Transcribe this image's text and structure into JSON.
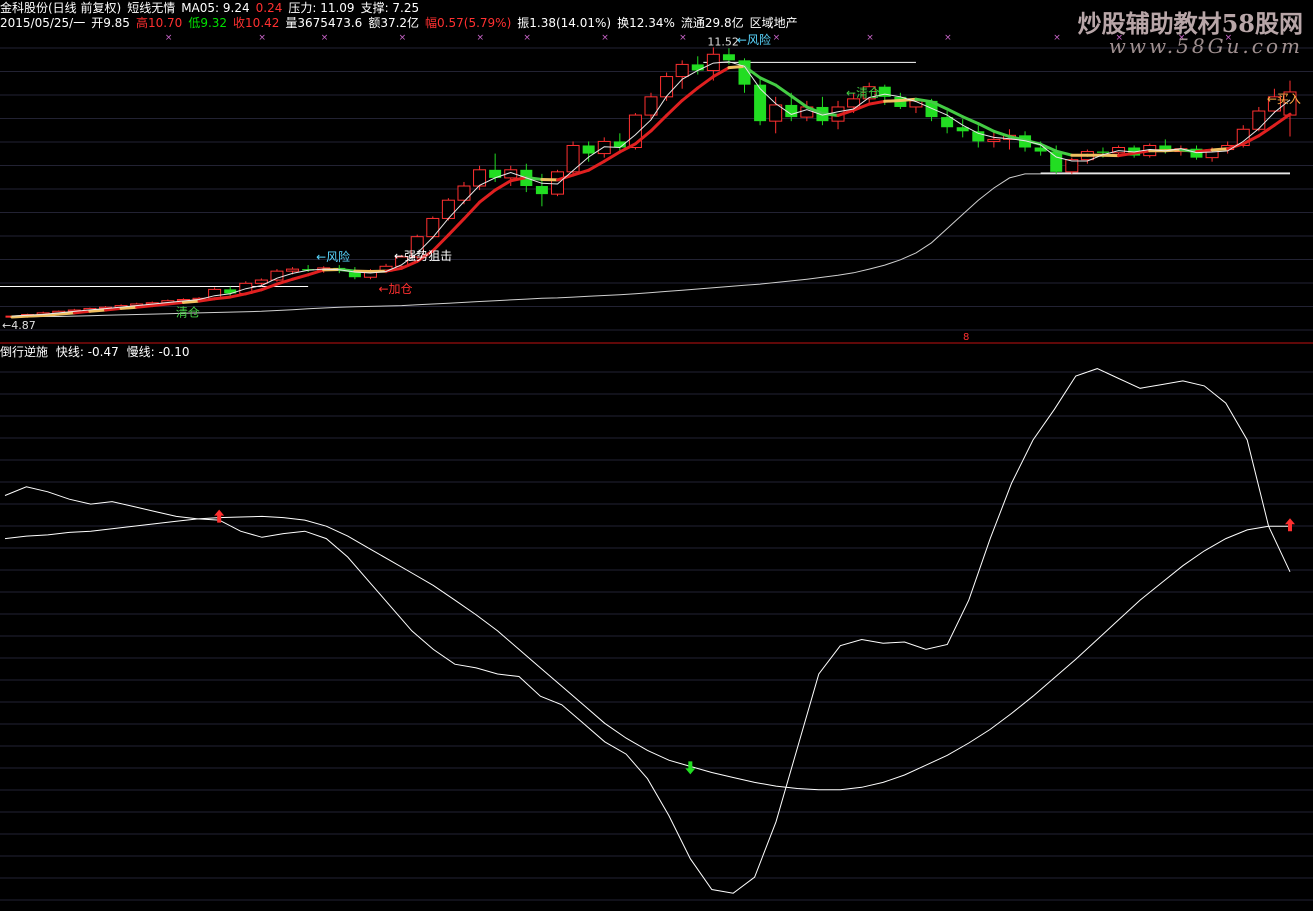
{
  "header": {
    "line1": [
      {
        "text": "金科股份(日线 前复权)",
        "color": "#ffffff"
      },
      {
        "text": "短线无情",
        "color": "#ffffff"
      },
      {
        "text": "MA05: 9.24",
        "color": "#ffffff"
      },
      {
        "text": "0.24",
        "color": "#ff3030"
      },
      {
        "text": "压力: 11.09",
        "color": "#ffffff"
      },
      {
        "text": "支撑: 7.25",
        "color": "#ffffff"
      }
    ],
    "line2": [
      {
        "text": "2015/05/25/一",
        "color": "#ffffff"
      },
      {
        "text": "开9.85",
        "color": "#ffffff"
      },
      {
        "text": "高10.70",
        "color": "#ff3030"
      },
      {
        "text": "低9.32",
        "color": "#00e000"
      },
      {
        "text": "收10.42",
        "color": "#ff3030"
      },
      {
        "text": "量3675473.6",
        "color": "#ffffff"
      },
      {
        "text": "额37.2亿",
        "color": "#ffffff"
      },
      {
        "text": "幅0.57(5.79%)",
        "color": "#ff3030"
      },
      {
        "text": "振1.38(14.01%)",
        "color": "#ffffff"
      },
      {
        "text": "换12.34%",
        "color": "#ffffff"
      },
      {
        "text": "流通29.8亿",
        "color": "#ffffff"
      },
      {
        "text": "区域地产",
        "color": "#ffffff"
      }
    ]
  },
  "watermark": {
    "line1": "炒股辅助教材58股网",
    "line2": "www.58Gu.com"
  },
  "indicator_header": {
    "name": "倒行逆施",
    "fast": "快线: -0.47",
    "slow": "慢线: -0.10"
  },
  "divider_marker": "8",
  "colors": {
    "up": "#ff3030",
    "down": "#22dd22",
    "background": "#000000",
    "line": "#ffffff",
    "grid": "#222233"
  },
  "chart_data": [
    {
      "type": "candlestick",
      "candles": [
        [
          4.87,
          4.9,
          4.84,
          4.89
        ],
        [
          4.89,
          4.95,
          4.86,
          4.93
        ],
        [
          4.93,
          5.0,
          4.9,
          4.97
        ],
        [
          4.97,
          5.03,
          4.94,
          5.01
        ],
        [
          5.01,
          5.07,
          4.98,
          5.04
        ],
        [
          5.04,
          5.1,
          5.0,
          5.08
        ],
        [
          5.08,
          5.14,
          5.04,
          5.11
        ],
        [
          5.11,
          5.18,
          5.06,
          5.15
        ],
        [
          5.15,
          5.22,
          5.1,
          5.19
        ],
        [
          5.19,
          5.25,
          5.13,
          5.22
        ],
        [
          5.22,
          5.3,
          5.18,
          5.27
        ],
        [
          5.27,
          5.33,
          5.22,
          5.3
        ],
        [
          5.3,
          5.36,
          5.25,
          5.33
        ],
        [
          5.33,
          5.6,
          5.3,
          5.55
        ],
        [
          5.55,
          5.62,
          5.4,
          5.45
        ],
        [
          5.45,
          5.75,
          5.42,
          5.7
        ],
        [
          5.7,
          5.82,
          5.62,
          5.78
        ],
        [
          5.78,
          6.05,
          5.74,
          6.0
        ],
        [
          6.0,
          6.1,
          5.92,
          6.05
        ],
        [
          6.05,
          6.15,
          5.98,
          6.02
        ],
        [
          6.02,
          6.12,
          5.96,
          6.08
        ],
        [
          6.08,
          6.15,
          5.95,
          6.01
        ],
        [
          6.01,
          6.1,
          5.8,
          5.85
        ],
        [
          5.85,
          6.05,
          5.8,
          6.0
        ],
        [
          6.0,
          6.18,
          5.95,
          6.12
        ],
        [
          6.12,
          6.4,
          6.05,
          6.35
        ],
        [
          6.35,
          6.9,
          6.3,
          6.85
        ],
        [
          6.85,
          7.35,
          6.8,
          7.3
        ],
        [
          7.3,
          7.8,
          7.25,
          7.75
        ],
        [
          7.75,
          8.2,
          7.65,
          8.1
        ],
        [
          8.1,
          8.6,
          8.0,
          8.5
        ],
        [
          8.5,
          8.9,
          8.2,
          8.3
        ],
        [
          8.3,
          8.6,
          8.1,
          8.5
        ],
        [
          8.5,
          8.65,
          7.95,
          8.1
        ],
        [
          8.1,
          8.4,
          7.6,
          7.9
        ],
        [
          7.9,
          8.5,
          7.85,
          8.45
        ],
        [
          8.45,
          9.2,
          8.4,
          9.1
        ],
        [
          9.1,
          9.2,
          8.7,
          8.9
        ],
        [
          8.9,
          9.3,
          8.8,
          9.2
        ],
        [
          9.2,
          9.4,
          8.95,
          9.05
        ],
        [
          9.05,
          9.9,
          9.0,
          9.85
        ],
        [
          9.85,
          10.4,
          9.75,
          10.3
        ],
        [
          10.3,
          10.9,
          10.2,
          10.8
        ],
        [
          10.8,
          11.2,
          10.5,
          11.1
        ],
        [
          11.1,
          11.3,
          10.85,
          10.95
        ],
        [
          10.95,
          11.52,
          10.7,
          11.35
        ],
        [
          11.35,
          11.5,
          11.1,
          11.2
        ],
        [
          11.2,
          11.25,
          10.4,
          10.6
        ],
        [
          10.6,
          10.8,
          9.6,
          9.7
        ],
        [
          9.7,
          10.3,
          9.4,
          10.1
        ],
        [
          10.1,
          10.4,
          9.7,
          9.8
        ],
        [
          9.8,
          10.2,
          9.7,
          10.05
        ],
        [
          10.05,
          10.3,
          9.6,
          9.7
        ],
        [
          9.7,
          10.2,
          9.5,
          10.05
        ],
        [
          10.05,
          10.4,
          9.9,
          10.25
        ],
        [
          10.25,
          10.65,
          10.15,
          10.55
        ],
        [
          10.55,
          10.6,
          10.1,
          10.3
        ],
        [
          10.3,
          10.4,
          10.0,
          10.05
        ],
        [
          10.05,
          10.2,
          9.9,
          10.2
        ],
        [
          10.2,
          10.25,
          9.7,
          9.8
        ],
        [
          9.8,
          9.95,
          9.4,
          9.55
        ],
        [
          9.55,
          9.75,
          9.3,
          9.45
        ],
        [
          9.45,
          9.6,
          9.05,
          9.2
        ],
        [
          9.2,
          9.45,
          9.05,
          9.25
        ],
        [
          9.25,
          9.5,
          9.0,
          9.35
        ],
        [
          9.35,
          9.45,
          8.95,
          9.05
        ],
        [
          9.05,
          9.2,
          8.85,
          8.95
        ],
        [
          8.95,
          9.1,
          8.4,
          8.45
        ],
        [
          8.45,
          8.8,
          8.4,
          8.75
        ],
        [
          8.75,
          9.0,
          8.65,
          8.95
        ],
        [
          8.95,
          9.05,
          8.8,
          8.92
        ],
        [
          8.92,
          9.1,
          8.85,
          9.05
        ],
        [
          9.05,
          9.1,
          8.8,
          8.85
        ],
        [
          8.85,
          9.15,
          8.8,
          9.1
        ],
        [
          9.1,
          9.25,
          8.9,
          8.95
        ],
        [
          8.95,
          9.1,
          8.85,
          9.02
        ],
        [
          9.02,
          9.1,
          8.75,
          8.8
        ],
        [
          8.8,
          9.05,
          8.7,
          9.0
        ],
        [
          9.0,
          9.2,
          8.9,
          9.1
        ],
        [
          9.1,
          9.6,
          9.05,
          9.5
        ],
        [
          9.5,
          10.05,
          9.45,
          9.95
        ],
        [
          9.95,
          10.5,
          9.9,
          10.3
        ],
        [
          9.85,
          10.7,
          9.32,
          10.42
        ]
      ],
      "ma5": [
        4.87,
        4.89,
        4.91,
        4.94,
        4.97,
        5.01,
        5.04,
        5.08,
        5.11,
        5.15,
        5.19,
        5.23,
        5.26,
        5.32,
        5.36,
        5.44,
        5.54,
        5.68,
        5.8,
        5.91,
        6.03,
        6.04,
        6.0,
        5.99,
        6.0,
        6.07,
        6.24,
        6.5,
        6.89,
        7.29,
        7.7,
        8.0,
        8.23,
        8.31,
        8.26,
        8.25,
        8.37,
        8.49,
        8.71,
        8.94,
        9.14,
        9.46,
        9.84,
        10.21,
        10.52,
        10.8,
        11.02,
        11.05,
        10.77,
        10.59,
        10.32,
        10.05,
        9.89,
        9.84,
        9.97,
        10.12,
        10.19,
        10.21,
        10.24,
        10.18,
        10.0,
        9.81,
        9.64,
        9.45,
        9.32,
        9.23,
        9.13,
        8.96,
        8.86,
        8.86,
        8.86,
        8.85,
        8.91,
        8.97,
        8.97,
        8.99,
        8.95,
        8.99,
        9.02,
        9.14,
        9.34,
        9.6,
        9.87
      ],
      "ma_long": [
        4.87,
        4.87,
        4.88,
        4.88,
        4.89,
        4.9,
        4.91,
        4.92,
        4.93,
        4.94,
        4.95,
        4.96,
        4.97,
        4.98,
        4.99,
        5.0,
        5.01,
        5.03,
        5.05,
        5.07,
        5.09,
        5.11,
        5.12,
        5.13,
        5.14,
        5.15,
        5.17,
        5.19,
        5.21,
        5.23,
        5.25,
        5.27,
        5.29,
        5.31,
        5.33,
        5.34,
        5.36,
        5.38,
        5.4,
        5.42,
        5.44,
        5.47,
        5.5,
        5.53,
        5.56,
        5.59,
        5.62,
        5.65,
        5.68,
        5.72,
        5.76,
        5.8,
        5.85,
        5.9,
        5.96,
        6.05,
        6.15,
        6.28,
        6.45,
        6.7,
        7.05,
        7.4,
        7.75,
        8.05,
        8.3,
        8.4,
        8.4,
        8.4,
        8.4,
        8.4,
        8.4,
        8.4,
        8.4,
        8.4,
        8.4,
        8.4,
        8.4,
        8.4,
        8.4,
        8.4,
        8.4,
        8.4,
        8.4
      ],
      "labels": {
        "low": "←4.87",
        "high": "11.52",
        "resistance": "11.09",
        "support": "7.25"
      },
      "signals": [
        {
          "i": 10,
          "text": "清仓"
        },
        {
          "i": 19,
          "text": "←风险"
        },
        {
          "i": 23,
          "text": "←加仓"
        },
        {
          "i": 24,
          "text": "←强势狙击"
        },
        {
          "i": 46,
          "text": "←风险"
        },
        {
          "i": 53,
          "text": "←清仓"
        },
        {
          "i": 80,
          "text": "←买入"
        }
      ]
    },
    {
      "type": "line",
      "title": "倒行逆施",
      "series": [
        {
          "name": "快线",
          "values": [
            0.15,
            0.22,
            0.18,
            0.12,
            0.08,
            0.1,
            0.06,
            0.02,
            -0.02,
            -0.04,
            -0.05,
            -0.14,
            -0.19,
            -0.16,
            -0.14,
            -0.2,
            -0.35,
            -0.55,
            -0.75,
            -0.95,
            -1.1,
            -1.22,
            -1.25,
            -1.3,
            -1.32,
            -1.48,
            -1.55,
            -1.7,
            -1.85,
            -1.95,
            -2.15,
            -2.45,
            -2.8,
            -3.05,
            -3.08,
            -2.95,
            -2.5,
            -1.9,
            -1.3,
            -1.07,
            -1.02,
            -1.05,
            -1.04,
            -1.1,
            -1.06,
            -0.7,
            -0.2,
            0.25,
            0.6,
            0.85,
            1.12,
            1.18,
            1.1,
            1.02,
            1.05,
            1.08,
            1.04,
            0.9,
            0.6,
            -0.1,
            -0.47
          ]
        },
        {
          "name": "慢线",
          "values": [
            -0.2,
            -0.18,
            -0.17,
            -0.15,
            -0.14,
            -0.12,
            -0.1,
            -0.08,
            -0.06,
            -0.04,
            -0.03,
            -0.025,
            -0.02,
            -0.03,
            -0.05,
            -0.1,
            -0.18,
            -0.28,
            -0.38,
            -0.48,
            -0.58,
            -0.7,
            -0.82,
            -0.95,
            -1.1,
            -1.25,
            -1.4,
            -1.55,
            -1.7,
            -1.82,
            -1.92,
            -2.0,
            -2.05,
            -2.1,
            -2.14,
            -2.18,
            -2.21,
            -2.23,
            -2.24,
            -2.24,
            -2.22,
            -2.18,
            -2.12,
            -2.04,
            -1.96,
            -1.86,
            -1.75,
            -1.62,
            -1.48,
            -1.33,
            -1.18,
            -1.02,
            -0.86,
            -0.7,
            -0.56,
            -0.42,
            -0.3,
            -0.2,
            -0.13,
            -0.1,
            -0.1
          ]
        }
      ],
      "cross_signals": [
        {
          "i": 10,
          "dir": "up",
          "color": "#ff3030"
        },
        {
          "i": 32,
          "dir": "down",
          "color": "#22dd22"
        },
        {
          "i": 60,
          "dir": "up",
          "color": "#ff3030"
        }
      ]
    }
  ]
}
